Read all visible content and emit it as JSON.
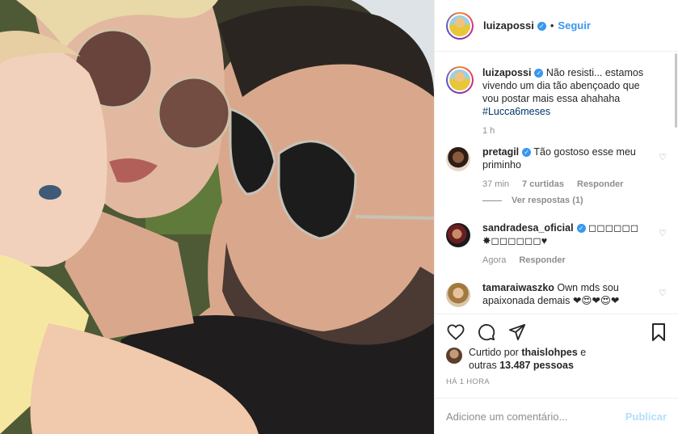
{
  "photo": {
    "description_icon": "post-photo"
  },
  "header": {
    "username": "luizapossi",
    "verified": true,
    "separator": "•",
    "follow_label": "Seguir"
  },
  "caption": {
    "username": "luizapossi",
    "text": "Não resisti... estamos vivendo um dia tão abençoado que vou postar mais essa ahahaha ",
    "hashtag": "#Lucca6meses",
    "time": "1 h"
  },
  "comments": [
    {
      "username": "pretagil",
      "verified": true,
      "text": "Tão gostoso esse meu priminho",
      "time": "37 min",
      "likes": "7 curtidas",
      "reply_label": "Responder",
      "see_replies": "Ver respostas (1)"
    },
    {
      "username": "sandradesa_oficial",
      "verified": true,
      "text": "◻◻◻◻◻◻ ✸◻◻◻◻◻◻♥",
      "time": "Agora",
      "reply_label": "Responder"
    },
    {
      "username": "tamaraiwaszko",
      "verified": false,
      "text": "Own mds sou apaixonada demais ❤😍❤😍❤"
    }
  ],
  "actions": {
    "like_icon": "heart-icon",
    "comment_icon": "comment-icon",
    "share_icon": "share-icon",
    "save_icon": "bookmark-icon"
  },
  "likes": {
    "prefix": "Curtido por ",
    "user": "thaislohpes",
    "mid": " e",
    "others_prefix": "outras ",
    "count": "13.487 pessoas"
  },
  "timestamp": "HÁ 1 HORA",
  "add_comment": {
    "placeholder": "Adicione um comentário...",
    "post_label": "Publicar"
  }
}
